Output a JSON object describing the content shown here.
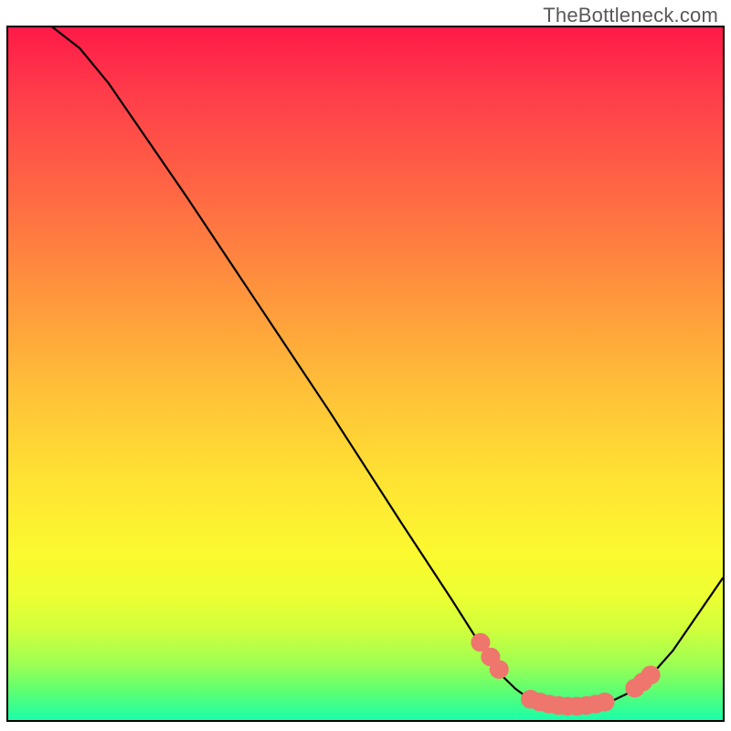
{
  "watermark": "TheBottleneck.com",
  "chart_data": {
    "type": "line",
    "title": "",
    "xlabel": "",
    "ylabel": "",
    "xlim": [
      0,
      100
    ],
    "ylim": [
      0,
      100
    ],
    "grid": false,
    "legend": false,
    "curve": [
      {
        "x": 0,
        "y": 105
      },
      {
        "x": 5,
        "y": 101
      },
      {
        "x": 10,
        "y": 97
      },
      {
        "x": 14,
        "y": 92
      },
      {
        "x": 18,
        "y": 86
      },
      {
        "x": 25,
        "y": 75.5
      },
      {
        "x": 35,
        "y": 60
      },
      {
        "x": 45,
        "y": 44.5
      },
      {
        "x": 55,
        "y": 28.5
      },
      {
        "x": 62,
        "y": 17.5
      },
      {
        "x": 66,
        "y": 11
      },
      {
        "x": 69,
        "y": 6.5
      },
      {
        "x": 71,
        "y": 4.5
      },
      {
        "x": 73,
        "y": 3
      },
      {
        "x": 76,
        "y": 2.1
      },
      {
        "x": 80,
        "y": 2
      },
      {
        "x": 84,
        "y": 2.5
      },
      {
        "x": 87,
        "y": 4
      },
      {
        "x": 90,
        "y": 6.5
      },
      {
        "x": 93,
        "y": 10
      },
      {
        "x": 96,
        "y": 14.5
      },
      {
        "x": 100,
        "y": 20.5
      }
    ],
    "markers": [
      {
        "x": 66.1,
        "y": 11.2
      },
      {
        "x": 67.5,
        "y": 9.1
      },
      {
        "x": 68.7,
        "y": 7.3
      },
      {
        "x": 73.1,
        "y": 3.0
      },
      {
        "x": 74.4,
        "y": 2.6
      },
      {
        "x": 75.7,
        "y": 2.3
      },
      {
        "x": 77.0,
        "y": 2.1
      },
      {
        "x": 78.3,
        "y": 2.0
      },
      {
        "x": 79.6,
        "y": 2.0
      },
      {
        "x": 80.9,
        "y": 2.1
      },
      {
        "x": 82.2,
        "y": 2.3
      },
      {
        "x": 83.5,
        "y": 2.6
      },
      {
        "x": 87.7,
        "y": 4.6
      },
      {
        "x": 88.8,
        "y": 5.5
      },
      {
        "x": 89.9,
        "y": 6.5
      }
    ]
  }
}
